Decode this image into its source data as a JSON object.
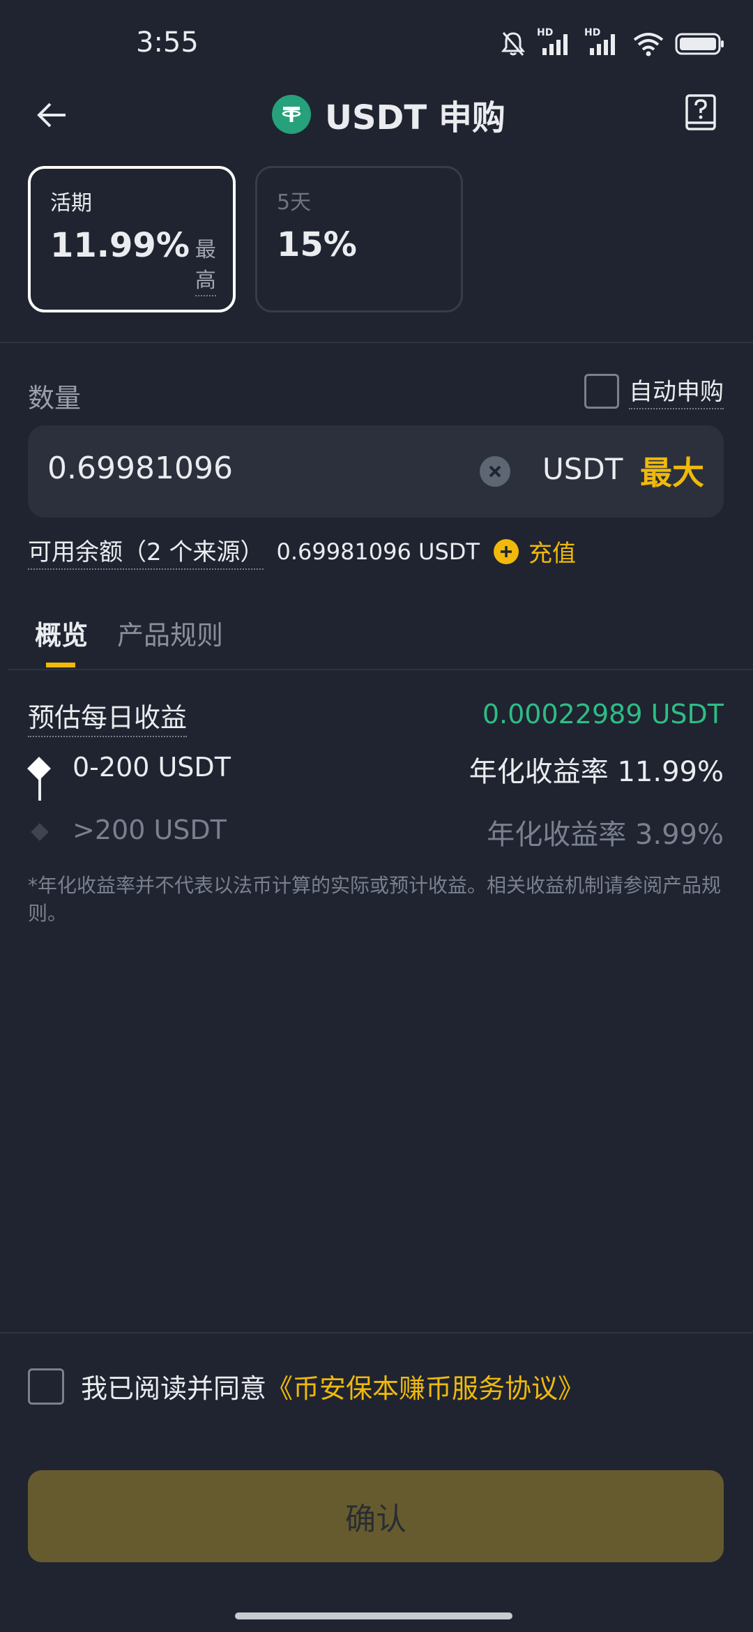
{
  "status_bar": {
    "time": "3:55",
    "icons": [
      "bell-off-icon",
      "signal-hd-icon",
      "signal-hd-icon",
      "wifi-icon",
      "battery-icon"
    ],
    "hd_label": "HD"
  },
  "header": {
    "title": "USDT 申购",
    "coin_icon": "tether-icon"
  },
  "products": [
    {
      "term": "活期",
      "rate": "11.99%",
      "tag": "最高",
      "selected": true
    },
    {
      "term": "5天",
      "rate": "15%",
      "selected": false
    }
  ],
  "amount": {
    "label": "数量",
    "auto_subscribe_label": "自动申购",
    "value": "0.69981096",
    "currency": "USDT",
    "max_label": "最大"
  },
  "balance": {
    "label": "可用余额（2 个来源）",
    "value": "0.69981096 USDT",
    "topup_label": "充值"
  },
  "tabs": [
    {
      "label": "概览",
      "active": true
    },
    {
      "label": "产品规则",
      "active": false
    }
  ],
  "overview": {
    "estimate_label": "预估每日收益",
    "estimate_value": "0.00022989 USDT",
    "tiers": [
      {
        "range": "0-200 USDT",
        "rate_label": "年化收益率",
        "rate": "11.99%"
      },
      {
        "range": ">200 USDT",
        "rate_label": "年化收益率",
        "rate": "3.99%"
      }
    ],
    "disclaimer": "*年化收益率并不代表以法币计算的实际或预计收益。相关收益机制请参阅产品规则。"
  },
  "agreement": {
    "text": "我已阅读并同意",
    "link": "《币安保本赚币服务协议》"
  },
  "confirm": {
    "label": "确认"
  },
  "colors": {
    "background": "#1f2430",
    "accent": "#f0b90b",
    "positive": "#2ebd85",
    "tether": "#26a17b"
  }
}
